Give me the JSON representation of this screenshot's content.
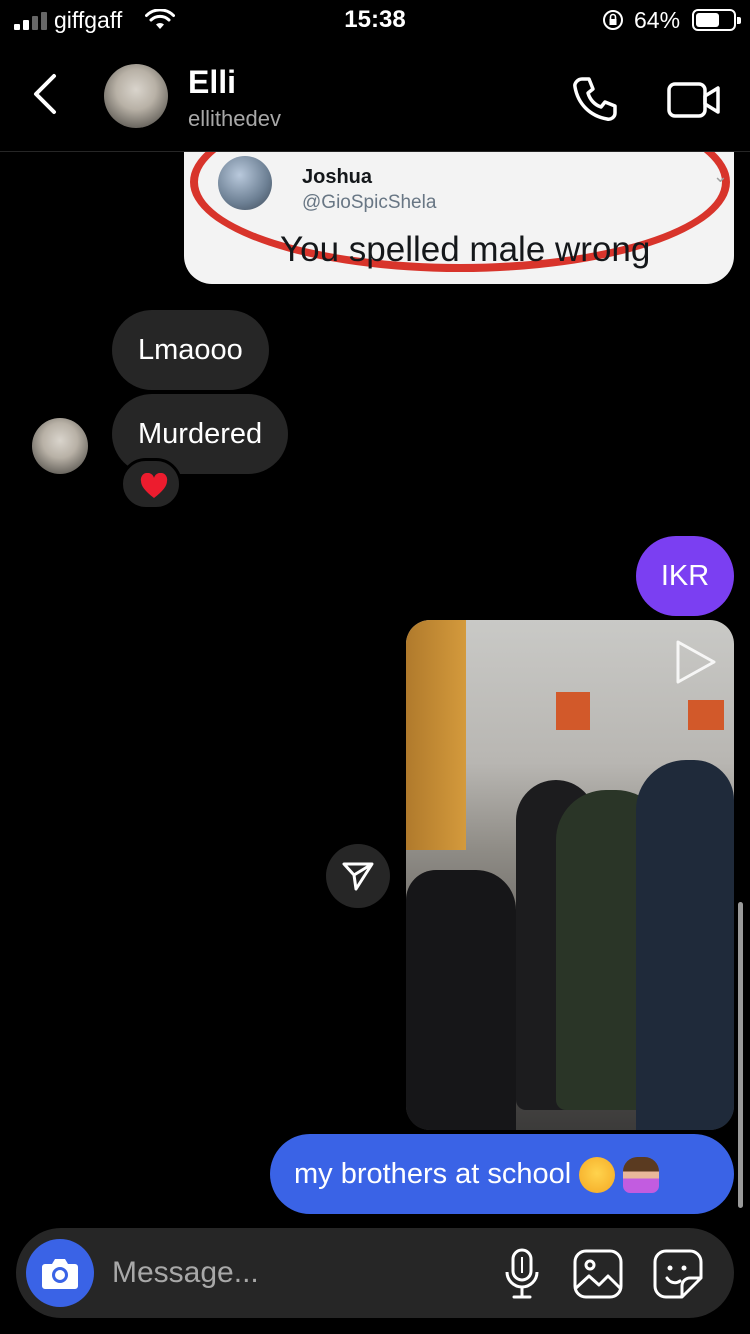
{
  "status_bar": {
    "carrier": "giffgaff",
    "time": "15:38",
    "battery": "64%",
    "battery_level": 0.64
  },
  "header": {
    "name": "Elli",
    "username": "ellithedev",
    "icons": [
      "back-icon",
      "phone-icon",
      "video-call-icon"
    ]
  },
  "tweet_share": {
    "author": "Joshua",
    "handle": "@GioSpicShela",
    "text": "You spelled male wrong"
  },
  "messages_in": [
    {
      "text": "Lmaooo"
    },
    {
      "text": "Murdered",
      "reaction": "heart"
    }
  ],
  "messages_out": {
    "ikr": "IKR",
    "caption": "my brothers at school",
    "caption_emojis": [
      "😹",
      "🤷‍♀️"
    ]
  },
  "composer": {
    "placeholder": "Message...",
    "icons": [
      "camera-icon",
      "microphone-icon",
      "gallery-icon",
      "sticker-icon"
    ]
  },
  "colors": {
    "background": "#000000",
    "incoming_bubble": "#262626",
    "outgoing_purple": "#7b3ff2",
    "outgoing_blue": "#3a63e6"
  }
}
